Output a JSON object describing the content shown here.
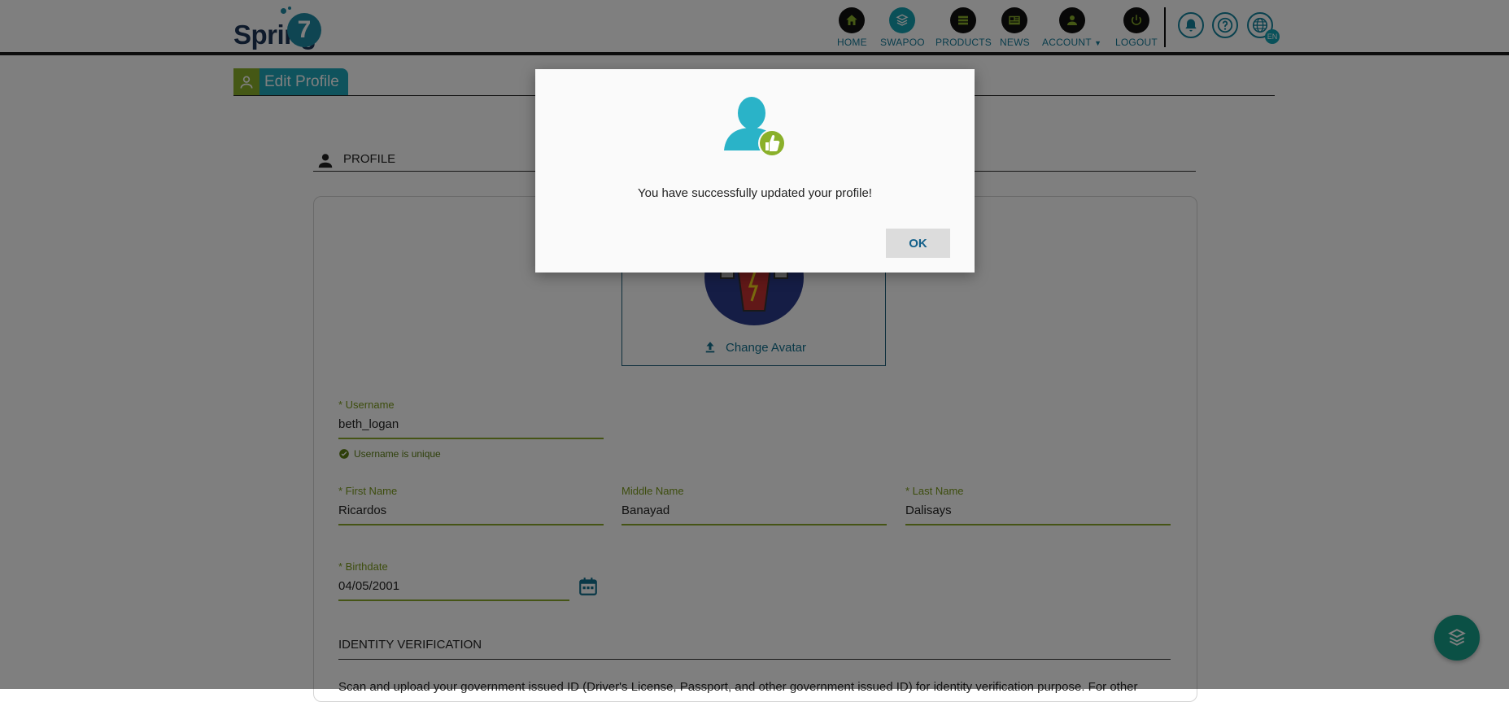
{
  "brand": {
    "word": "Spring",
    "numeral": "7"
  },
  "nav": [
    {
      "label": "HOME",
      "icon": "home-icon"
    },
    {
      "label": "SWAPOO",
      "icon": "swapoo-icon"
    },
    {
      "label": "PRODUCTS",
      "icon": "products-icon"
    },
    {
      "label": "NEWS",
      "icon": "news-icon"
    },
    {
      "label": "ACCOUNT",
      "icon": "account-icon"
    },
    {
      "label": "LOGOUT",
      "icon": "power-icon"
    }
  ],
  "language_badge": "EN",
  "page_tab": {
    "label": "Edit Profile"
  },
  "section": {
    "title": "PROFILE"
  },
  "avatar": {
    "change_label": "Change Avatar"
  },
  "form": {
    "username": {
      "label": "* Username",
      "value": "beth_logan",
      "hint": "Username is unique"
    },
    "first_name": {
      "label": "* First Name",
      "value": "Ricardos"
    },
    "middle_name": {
      "label": "Middle Name",
      "value": "Banayad"
    },
    "last_name": {
      "label": "* Last Name",
      "value": "Dalisays"
    },
    "birthdate": {
      "label": "* Birthdate",
      "value": "04/05/2001"
    }
  },
  "identity": {
    "title": "IDENTITY VERIFICATION",
    "text": "Scan and upload your government issued ID (Driver's License, Passport, and other government issued ID) for identity verification purpose. For other"
  },
  "modal": {
    "message": "You have successfully updated your profile!",
    "ok_label": "OK"
  },
  "colors": {
    "teal": "#1fa6ba",
    "green": "#8ab02a",
    "link": "#13708f",
    "fab": "#17a08a"
  }
}
